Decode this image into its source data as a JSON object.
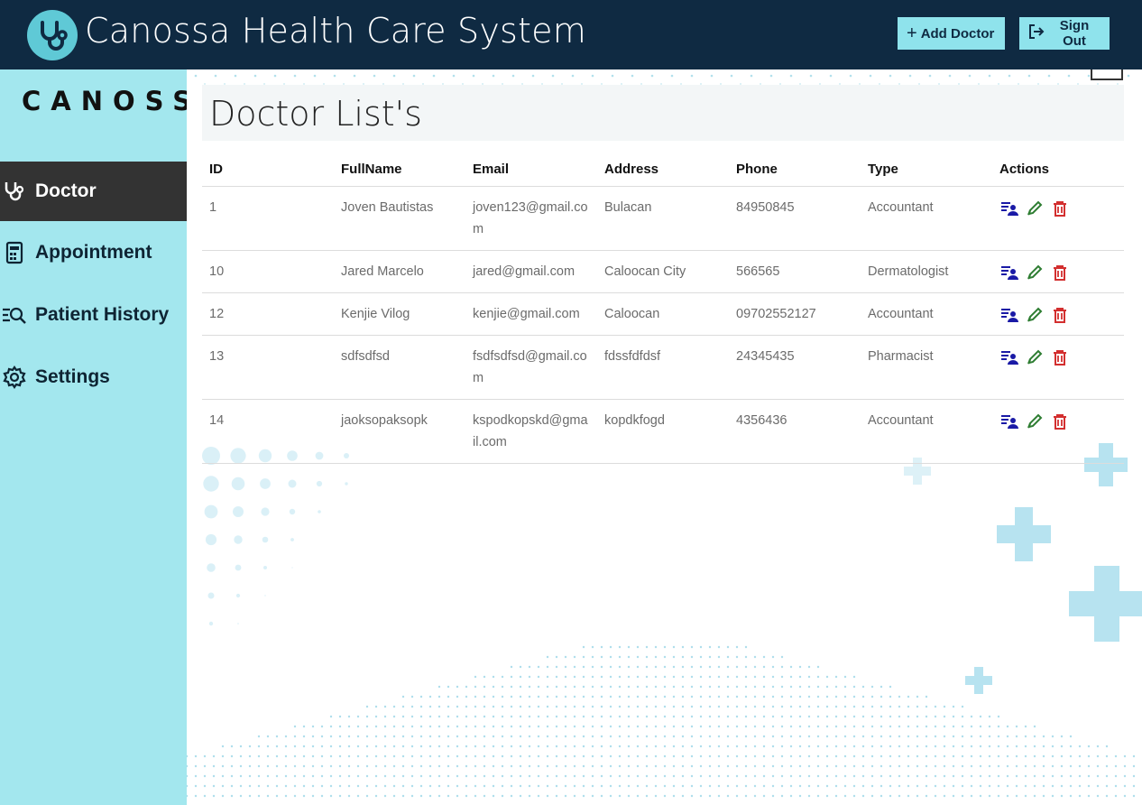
{
  "header": {
    "title": "Canossa Health Care System",
    "add_doctor_label": "Add Doctor",
    "sign_out_label": "Sign Out"
  },
  "sidebar": {
    "brand": "CANOSSA",
    "items": [
      {
        "label": "Doctor",
        "icon": "stethoscope-icon",
        "active": true
      },
      {
        "label": "Appointment",
        "icon": "calendar-icon",
        "active": false
      },
      {
        "label": "Patient History",
        "icon": "list-search-icon",
        "active": false
      },
      {
        "label": "Settings",
        "icon": "gear-icon",
        "active": false
      }
    ]
  },
  "main": {
    "title": "Doctor List's",
    "table": {
      "columns": [
        "ID",
        "FullName",
        "Email",
        "Address",
        "Phone",
        "Type",
        "Actions"
      ],
      "rows": [
        {
          "id": "1",
          "fullname": "Joven Bautistas",
          "email": "joven123@gmail.com",
          "address": "Bulacan",
          "phone": "84950845",
          "type": "Accountant"
        },
        {
          "id": "10",
          "fullname": "Jared Marcelo",
          "email": "jared@gmail.com",
          "address": "Caloocan City",
          "phone": "566565",
          "type": "Dermatologist"
        },
        {
          "id": "12",
          "fullname": "Kenjie Vilog",
          "email": "kenjie@gmail.com",
          "address": "Caloocan",
          "phone": "09702552127",
          "type": "Accountant"
        },
        {
          "id": "13",
          "fullname": "sdfsdfsd",
          "email": "fsdfsdfsd@gmail.com",
          "address": "fdssfdfdsf",
          "phone": "24345435",
          "type": "Pharmacist"
        },
        {
          "id": "14",
          "fullname": "jaoksopaksopk",
          "email": "kspodkopskd@gmail.com",
          "address": "kopdkfogd",
          "phone": "4356436",
          "type": "Accountant"
        }
      ]
    }
  },
  "colors": {
    "header_bg": "#0f2a42",
    "sidebar_bg": "#a3e7ee",
    "active_nav_bg": "#333333",
    "button_bg": "#8fe3ec",
    "view_icon": "#1a1aa6",
    "edit_icon": "#2e7d32",
    "delete_icon": "#d32f2f"
  }
}
